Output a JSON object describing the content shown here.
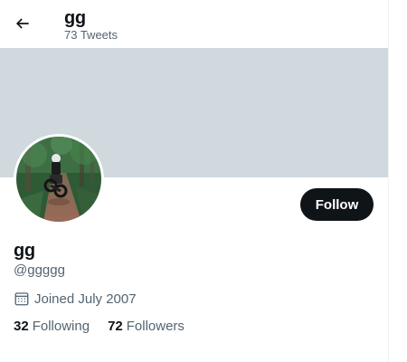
{
  "header": {
    "name": "gg",
    "tweet_count": "73 Tweets"
  },
  "profile": {
    "display_name": "gg",
    "handle": "@ggggg",
    "joined": "Joined July 2007",
    "follow_label": "Follow",
    "following_count": "32",
    "following_label": "Following",
    "followers_count": "72",
    "followers_label": "Followers"
  },
  "icons": {
    "back": "arrow-left-icon",
    "joined": "calendar-icon"
  },
  "colors": {
    "banner": "#cfd9de",
    "primary_text": "#0f1419",
    "secondary_text": "#536471",
    "follow_button": "#0f1419"
  }
}
